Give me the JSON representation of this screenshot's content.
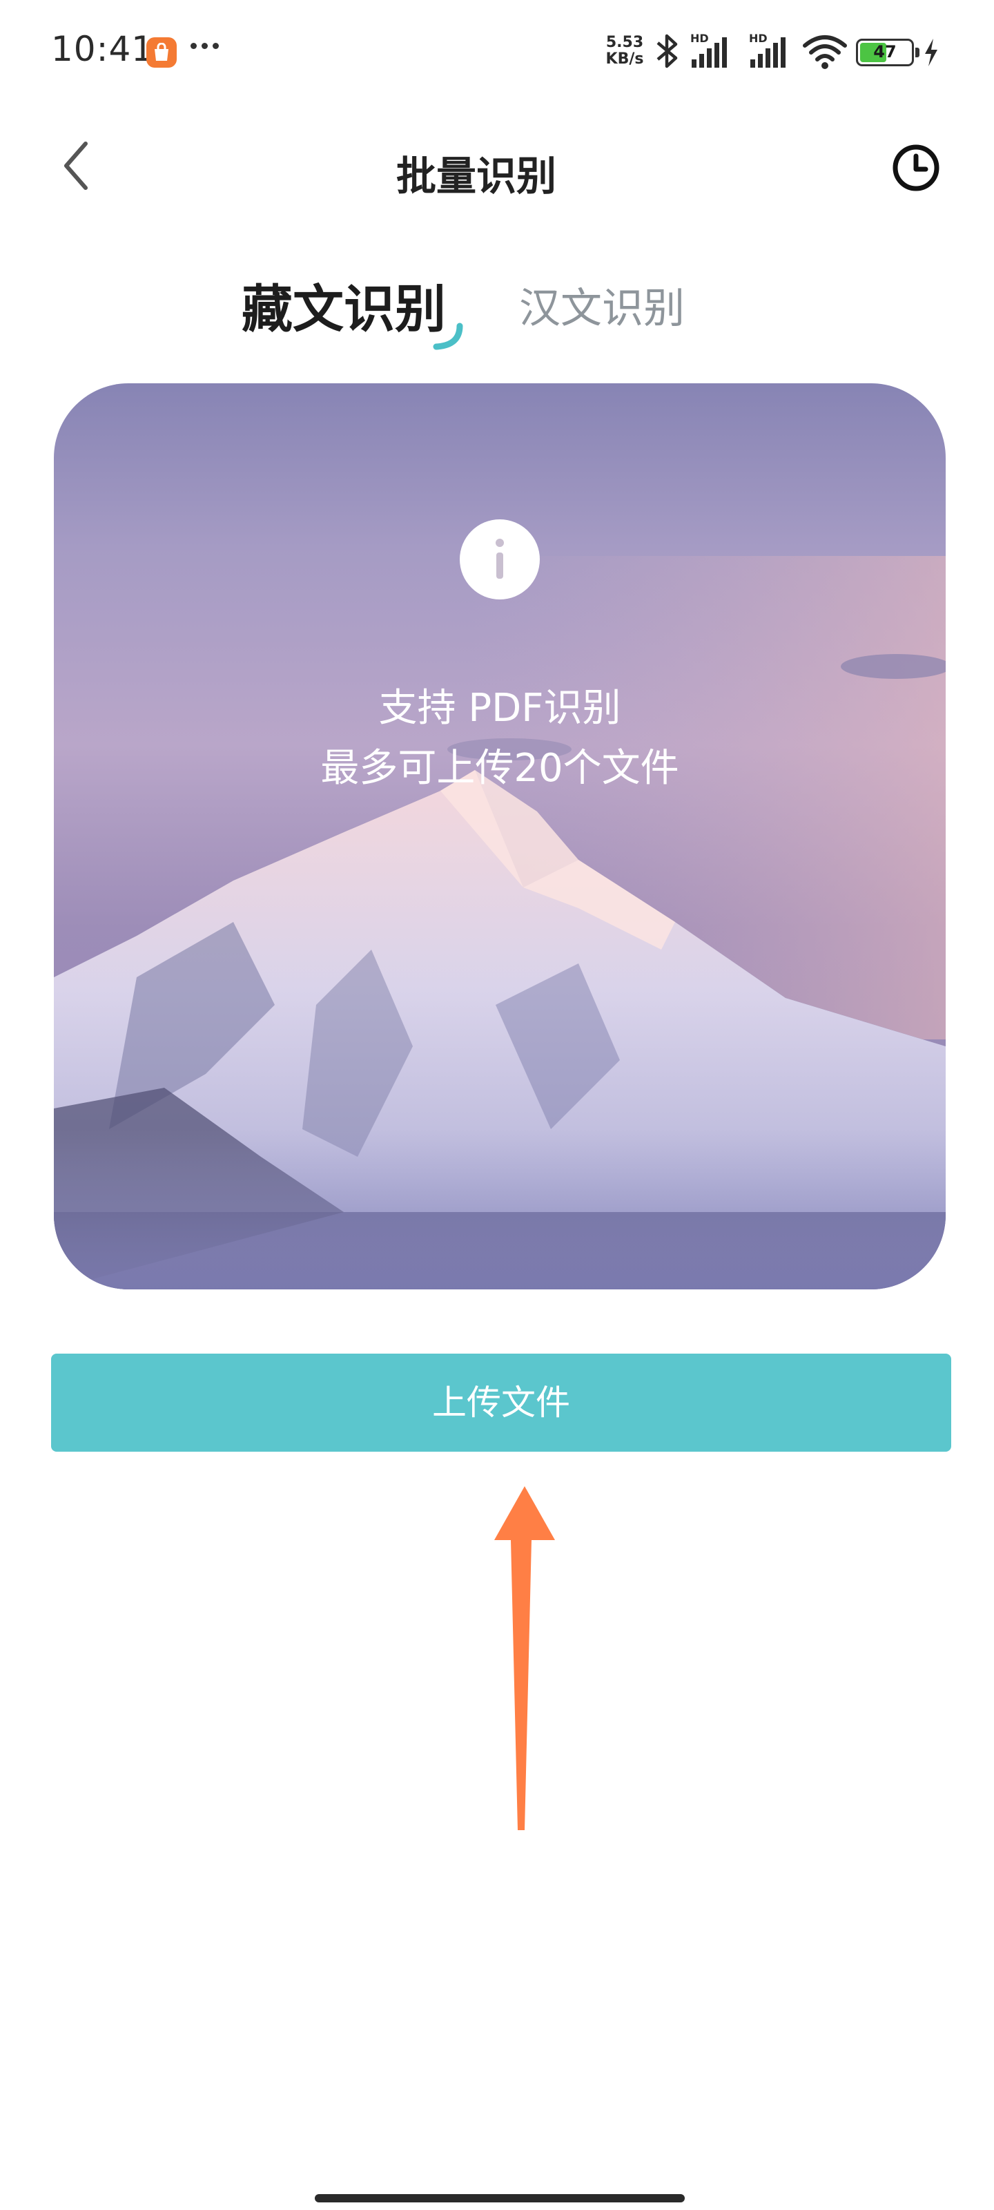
{
  "status_bar": {
    "time": "10:41",
    "app_icon": "shopping-bag-icon",
    "more": "more-dots-icon",
    "net_speed_value": "5.53",
    "net_speed_unit": "KB/s",
    "signal_label_1": "HD",
    "signal_label_2": "HD",
    "battery_level": "47",
    "icons": [
      "bluetooth-icon",
      "signal-icon",
      "signal-icon",
      "wifi-icon",
      "battery-icon",
      "charging-icon"
    ]
  },
  "header": {
    "title": "批量识别",
    "back_icon": "back-chevron-icon",
    "history_icon": "clock-icon"
  },
  "tabs": [
    {
      "label": "藏文识别",
      "active": true
    },
    {
      "label": "汉文识别",
      "active": false
    }
  ],
  "hero": {
    "info_icon": "info-icon",
    "line1": "支持 PDF识别",
    "line2": "最多可上传20个文件"
  },
  "upload_button": {
    "label": "上传文件"
  },
  "colors": {
    "accent": "#5bc6cd",
    "arrow": "#ff7f45",
    "title_text": "#222222",
    "inactive_tab": "#8e959b"
  }
}
